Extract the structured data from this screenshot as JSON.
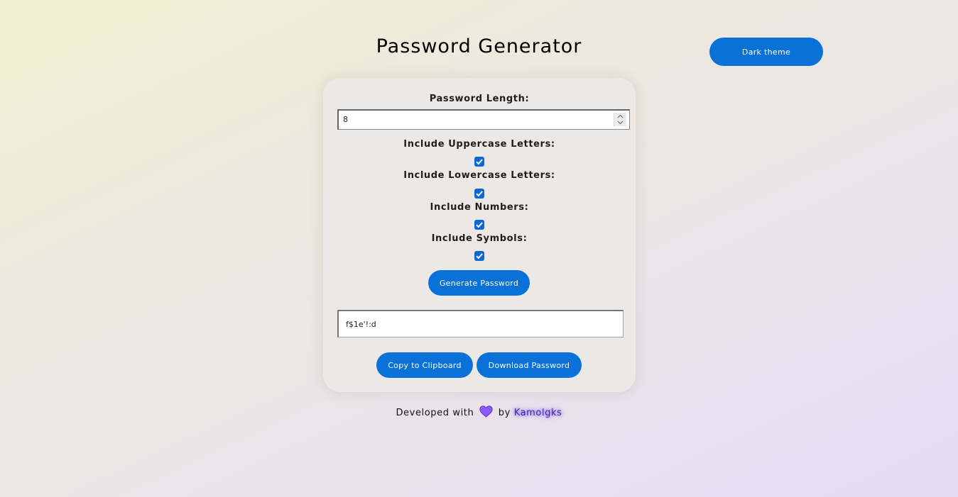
{
  "header": {
    "title": "Password Generator",
    "theme_button": "Dark theme"
  },
  "form": {
    "length_label": "Password Length:",
    "length_value": "8",
    "options": [
      {
        "label": "Include Uppercase Letters:",
        "checked": true
      },
      {
        "label": "Include Lowercase Letters:",
        "checked": true
      },
      {
        "label": "Include Numbers:",
        "checked": true
      },
      {
        "label": "Include Symbols:",
        "checked": true
      }
    ],
    "generate_button": "Generate Password"
  },
  "output": {
    "password": "f$1e'!:d"
  },
  "actions": {
    "copy_button": "Copy to Clipboard",
    "download_button": "Download Password"
  },
  "footer": {
    "text_before": "Developed with",
    "text_by": "by",
    "author": "Kamolgks",
    "heart_icon": "heart-icon"
  },
  "colors": {
    "accent": "#0a71d9",
    "heart": "#8b5cf6"
  }
}
